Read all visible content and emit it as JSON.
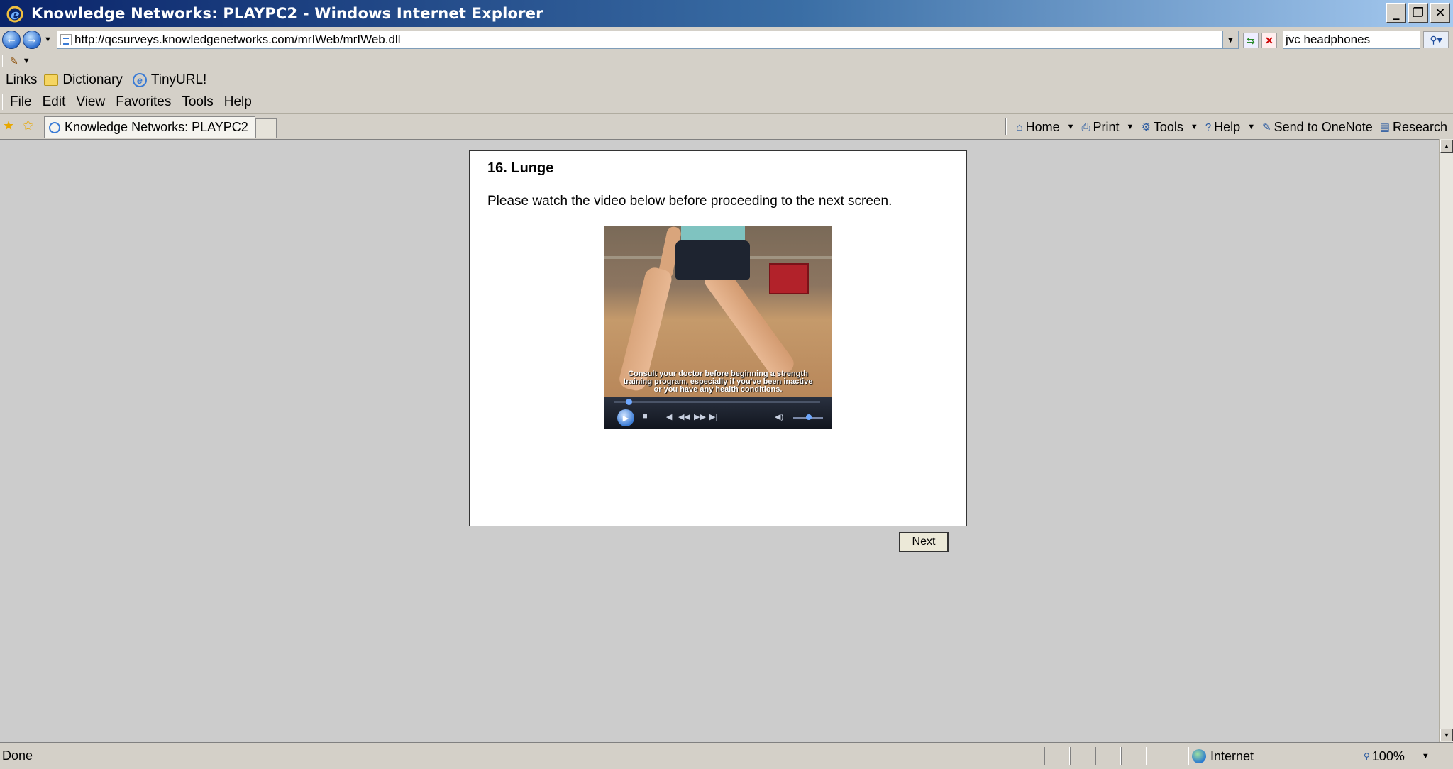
{
  "window": {
    "title": "Knowledge Networks: PLAYPC2 - Windows Internet Explorer",
    "minimize_label": "_",
    "restore_label": "❐",
    "close_label": "✕"
  },
  "address_bar": {
    "back_glyph": "←",
    "forward_glyph": "→",
    "url": "http://qcsurveys.knowledgenetworks.com/mrIWeb/mrIWeb.dll",
    "search_value": "jvc headphones"
  },
  "links_bar": {
    "label": "Links",
    "items": [
      {
        "label": "Dictionary",
        "icon": "folder-icon"
      },
      {
        "label": "TinyURL!",
        "icon": "ie-icon"
      }
    ]
  },
  "menu": {
    "items": [
      "File",
      "Edit",
      "View",
      "Favorites",
      "Tools",
      "Help"
    ]
  },
  "tabs": {
    "active_tab": "Knowledge Networks: PLAYPC2"
  },
  "command_bar": {
    "home": "Home",
    "print": "Print",
    "tools": "Tools",
    "help": "Help",
    "onenote": "Send to OneNote",
    "research": "Research"
  },
  "survey": {
    "question_title": "16. Lunge",
    "instruction": "Please watch the video below before proceeding to the next screen.",
    "video_caption_lines": [
      "Consult your doctor before beginning a strength",
      "training program, especially if you've been inactive",
      "or you have any health conditions."
    ],
    "next_label": "Next"
  },
  "status_bar": {
    "status": "Done",
    "zone": "Internet",
    "zoom": "100%"
  },
  "colors": {
    "titlebar_start": "#0a246a",
    "titlebar_end": "#a6caf0",
    "chrome": "#d4d0c8",
    "content_bg": "#cccccc"
  }
}
